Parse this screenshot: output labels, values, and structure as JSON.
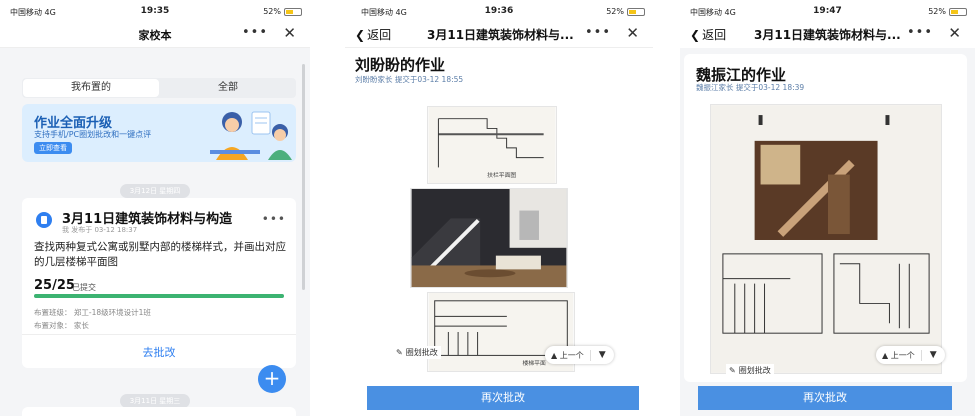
{
  "phone1": {
    "status": {
      "carrier": "中国移动 4G",
      "time": "19:35",
      "battery": "52%"
    },
    "title": "家校本",
    "tabs": [
      {
        "label": "我布置的"
      },
      {
        "label": "全部"
      }
    ],
    "banner": {
      "title": "作业全面升级",
      "subtitle": "支持手机/PC圈划批改和一键点评",
      "button": "立即查看"
    },
    "date1": "3月12日 星期四",
    "card": {
      "title": "3月11日建筑装饰材料与构造",
      "meta": "我 发布于 03-12 18:37",
      "description": "查找两种复式公寓或别墅内部的楼梯样式，并画出对应的几层楼梯平面图",
      "count": "25/25",
      "count_label": "已提交",
      "progress": 1.0,
      "class_label": "布置班级：",
      "class_value": "郑工-18级环境设计1班",
      "target_label": "布置对象：",
      "target_value": "家长",
      "action": "去批改"
    },
    "date2": "3月11日 星期三",
    "fab": "+"
  },
  "phone2": {
    "status": {
      "carrier": "中国移动 4G",
      "time": "19:36",
      "battery": "52%"
    },
    "back": "返回",
    "title": "3月11日建筑装饰材料与...",
    "heading": "刘盼盼的作业",
    "sub": "刘盼盼家长 提交于03-12 18:55",
    "sketch_caption1": "扶栏平面图",
    "sketch_caption2": "楼梯平面",
    "draw": "圈划批改",
    "prev": "▲ 上一个",
    "next": "▼",
    "action": "再次批改"
  },
  "phone3": {
    "status": {
      "carrier": "中国移动 4G",
      "time": "19:47",
      "battery": "52%"
    },
    "back": "返回",
    "title": "3月11日建筑装饰材料与...",
    "heading": "魏振江的作业",
    "sub": "魏振江家长 提交于03-12 18:39",
    "draw": "圈划批改",
    "prev": "▲ 上一个",
    "next": "▼",
    "action": "再次批改"
  },
  "colors": {
    "accent": "#2f7ff0",
    "button": "#4a90e2",
    "progress": "#3cb371",
    "banner": "#dceefe"
  }
}
